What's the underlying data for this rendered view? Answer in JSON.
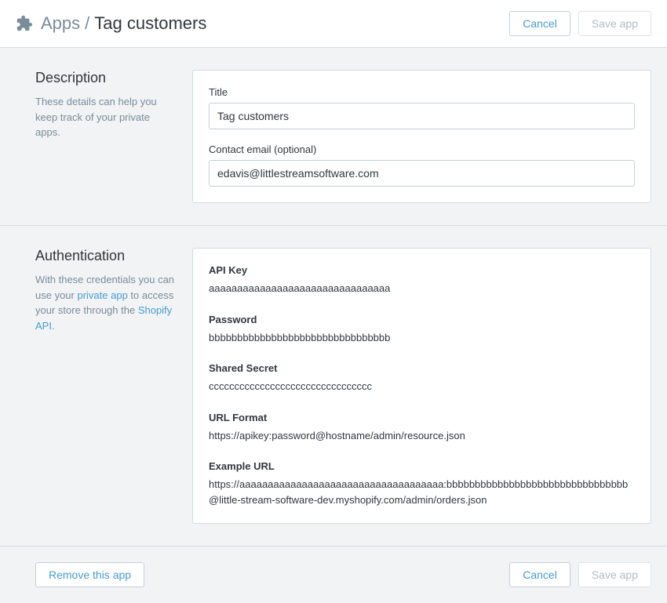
{
  "header": {
    "breadcrumb_root": "Apps",
    "breadcrumb_sep": "/",
    "breadcrumb_current": "Tag customers",
    "cancel_label": "Cancel",
    "save_label": "Save app"
  },
  "description": {
    "heading": "Description",
    "help_text": "These details can help you keep track of your private apps.",
    "title_label": "Title",
    "title_value": "Tag customers",
    "email_label": "Contact email (optional)",
    "email_value": "edavis@littlestreamsoftware.com"
  },
  "authentication": {
    "heading": "Authentication",
    "help_prefix": "With these credentials you can use your ",
    "help_link1": "private app",
    "help_mid": " to access your store through the ",
    "help_link2": "Shopify API",
    "help_suffix": ".",
    "api_key_label": "API Key",
    "api_key_value": "aaaaaaaaaaaaaaaaaaaaaaaaaaaaaaaa",
    "password_label": "Password",
    "password_value": "bbbbbbbbbbbbbbbbbbbbbbbbbbbbbbbb",
    "shared_secret_label": "Shared Secret",
    "shared_secret_value": "cccccccccccccccccccccccccccccccc",
    "url_format_label": "URL Format",
    "url_format_value": "https://apikey:password@hostname/admin/resource.json",
    "example_url_label": "Example URL",
    "example_url_value": "https://aaaaaaaaaaaaaaaaaaaaaaaaaaaaaaaaaaaa:bbbbbbbbbbbbbbbbbbbbbbbbbbbbbbbb@little-stream-software-dev.myshopify.com/admin/orders.json"
  },
  "footer": {
    "remove_label": "Remove this app",
    "cancel_label": "Cancel",
    "save_label": "Save app"
  }
}
